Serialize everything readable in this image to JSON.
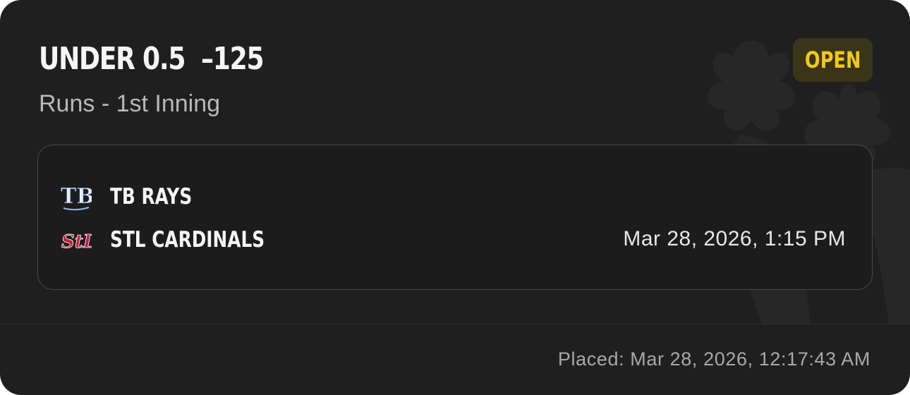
{
  "bet": {
    "title": "UNDER 0.5  –125",
    "market": "Runs - 1st Inning",
    "status": "OPEN"
  },
  "matchup": {
    "away_team": {
      "name": "TB RAYS",
      "logo_icon": "tb-rays-logo-icon",
      "logo_text": "TB"
    },
    "home_team": {
      "name": "STL CARDINALS",
      "logo_icon": "stl-cardinals-logo-icon",
      "logo_text": "StL"
    },
    "game_time": "Mar 28, 2026, 1:15 PM"
  },
  "footer": {
    "placed": "Placed: Mar 28, 2026, 12:17:43 AM"
  },
  "colors": {
    "card_background": "#1f1f1f",
    "status_badge_background": "#3a3419",
    "status_text": "#f2c81a",
    "cardinals_red": "#c41e3a"
  }
}
